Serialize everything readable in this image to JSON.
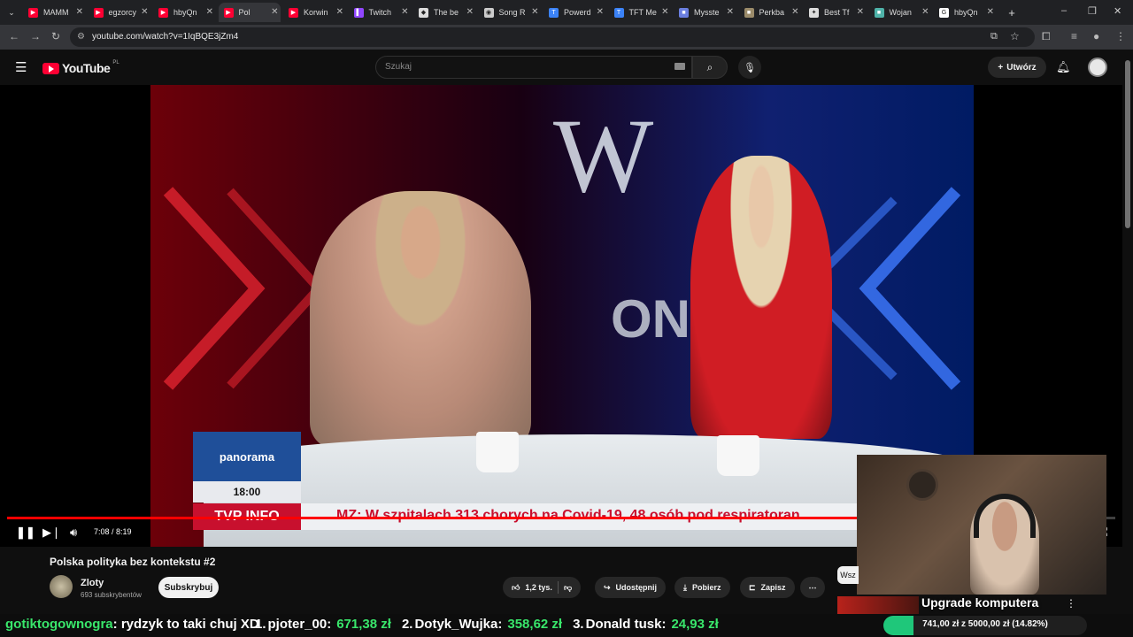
{
  "browser": {
    "tabs": [
      {
        "label": "MAMM",
        "favicon": "youtube-icon",
        "color": "#ff0033"
      },
      {
        "label": "egzorcy",
        "favicon": "youtube-icon",
        "color": "#ff0033"
      },
      {
        "label": "hbyQn",
        "favicon": "youtube-icon",
        "color": "#ff0033"
      },
      {
        "label": "Pol",
        "favicon": "youtube-icon",
        "color": "#ff0033"
      },
      {
        "label": "Korwin",
        "favicon": "youtube-icon",
        "color": "#ff0033"
      },
      {
        "label": "Twitch",
        "favicon": "twitch-icon",
        "color": "#9146ff"
      },
      {
        "label": "The be",
        "favicon": "shield-icon",
        "color": "#dddddd"
      },
      {
        "label": "Song R",
        "favicon": "globe-icon",
        "color": "#cccccc"
      },
      {
        "label": "Powerd",
        "favicon": "tft-icon",
        "color": "#3b82f6"
      },
      {
        "label": "TFT Me",
        "favicon": "tft-icon",
        "color": "#3b82f6"
      },
      {
        "label": "Mysste",
        "favicon": "square-icon",
        "color": "#6b7fe0"
      },
      {
        "label": "Perkba",
        "favicon": "square-icon",
        "color": "#9b8b6a"
      },
      {
        "label": "Best Tf",
        "favicon": "bolt-icon",
        "color": "#dddddd"
      },
      {
        "label": "Wojan",
        "favicon": "square-icon",
        "color": "#4fb3a9"
      },
      {
        "label": "hbyQn",
        "favicon": "google-icon",
        "color": "#ffffff"
      }
    ],
    "active_tab_index": 3,
    "new_tab": "+",
    "url": "youtube.com/watch?v=1IqBQE3jZm4"
  },
  "youtube": {
    "logo": "YouTube",
    "region": "PL",
    "search_placeholder": "Szukaj",
    "create_label": "Utwórz"
  },
  "video": {
    "elapsed": "7:08",
    "duration": "8:19",
    "time_display": "7:08 / 8:19",
    "progress_fraction": 0.856,
    "overlay": {
      "program": "panorama",
      "clock": "18:00",
      "channel": "TVP INFO",
      "ticker": "MZ: W szpitalach 313 chorych na Covid-19, 48 osób pod respiratoran"
    }
  },
  "meta": {
    "title": "Polska polityka bez kontekstu #2",
    "channel": "Zloty",
    "subscribers": "693 subskrybentów",
    "subscribe_label": "Subskrybuj",
    "likes": "1,2 tys.",
    "share_label": "Udostępnij",
    "download_label": "Pobierz",
    "save_label": "Zapisz",
    "filter_chip": "Wsz"
  },
  "stream_overlay": {
    "chat_user": "gotiktogownogra",
    "chat_message": ": rydzyk to taki chuj XD",
    "leaderboard": [
      {
        "rank": "1.",
        "name": "pjoter_00:",
        "amount": "671,38 zł"
      },
      {
        "rank": "2.",
        "name": "Dotyk_Wujka:",
        "amount": "358,62 zł"
      },
      {
        "rank": "3.",
        "name": "Donald tusk:",
        "amount": "24,93 zł"
      }
    ],
    "goal_title": "Upgrade komputera",
    "goal_text": "741,00 zł z 5000,00 zł (14.82%)",
    "goal_fraction": 0.1482,
    "colors": {
      "chat_user": "#39e66b",
      "amount": "#39e66b",
      "goal": "#1fc77a"
    }
  }
}
